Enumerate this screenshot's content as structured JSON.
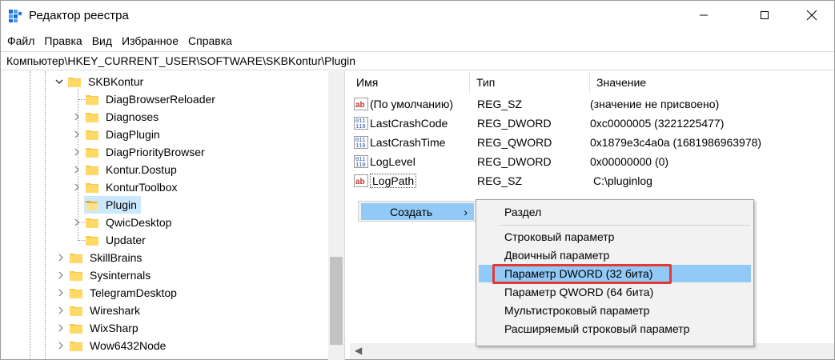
{
  "window": {
    "title": "Редактор реестра"
  },
  "menu": [
    "Файл",
    "Правка",
    "Вид",
    "Избранное",
    "Справка"
  ],
  "address": "Компьютер\\HKEY_CURRENT_USER\\SOFTWARE\\SKBKontur\\Plugin",
  "tree": {
    "items": [
      {
        "label": "SKBKontur",
        "expanded": true
      },
      {
        "label": "DiagBrowserReloader"
      },
      {
        "label": "Diagnoses"
      },
      {
        "label": "DiagPlugin"
      },
      {
        "label": "DiagPriorityBrowser"
      },
      {
        "label": "Kontur.Dostup"
      },
      {
        "label": "KonturToolbox"
      },
      {
        "label": "Plugin",
        "selected": true
      },
      {
        "label": "QwicDesktop"
      },
      {
        "label": "Updater"
      },
      {
        "label": "SkillBrains"
      },
      {
        "label": "Sysinternals"
      },
      {
        "label": "TelegramDesktop"
      },
      {
        "label": "Wireshark"
      },
      {
        "label": "WixSharp"
      },
      {
        "label": "Wow6432Node"
      }
    ]
  },
  "list": {
    "headers": {
      "name": "Имя",
      "type": "Тип",
      "value": "Значение"
    },
    "rows": [
      {
        "icon": "string-value-icon",
        "name": "(По умолчанию)",
        "type": "REG_SZ",
        "value": "(значение не присвоено)"
      },
      {
        "icon": "binary-value-icon",
        "name": "LastCrashCode",
        "type": "REG_DWORD",
        "value": "0xc0000005 (3221225477)"
      },
      {
        "icon": "binary-value-icon",
        "name": "LastCrashTime",
        "type": "REG_QWORD",
        "value": "0x1879e3c4a0a (1681986963978)"
      },
      {
        "icon": "binary-value-icon",
        "name": "LogLevel",
        "type": "REG_DWORD",
        "value": "0x00000000 (0)"
      },
      {
        "icon": "string-value-icon",
        "name": "LogPath",
        "type": "REG_SZ",
        "value": "C:\\pluginlog"
      }
    ]
  },
  "context_menu": {
    "create_label": "Создать",
    "create_arrow": "›",
    "submenu": [
      "Раздел",
      "Строковый параметр",
      "Двоичный параметр",
      "Параметр DWORD (32 бита)",
      "Параметр QWORD (64 бита)",
      "Мультистроковый параметр",
      "Расширяемый строковый параметр"
    ],
    "highlighted": "Параметр DWORD (32 бита)"
  },
  "colors": {
    "highlight": "#91c9f7",
    "selection": "#cce8ff",
    "annotation_box": "#e53935",
    "folder": "#f5c94c"
  }
}
